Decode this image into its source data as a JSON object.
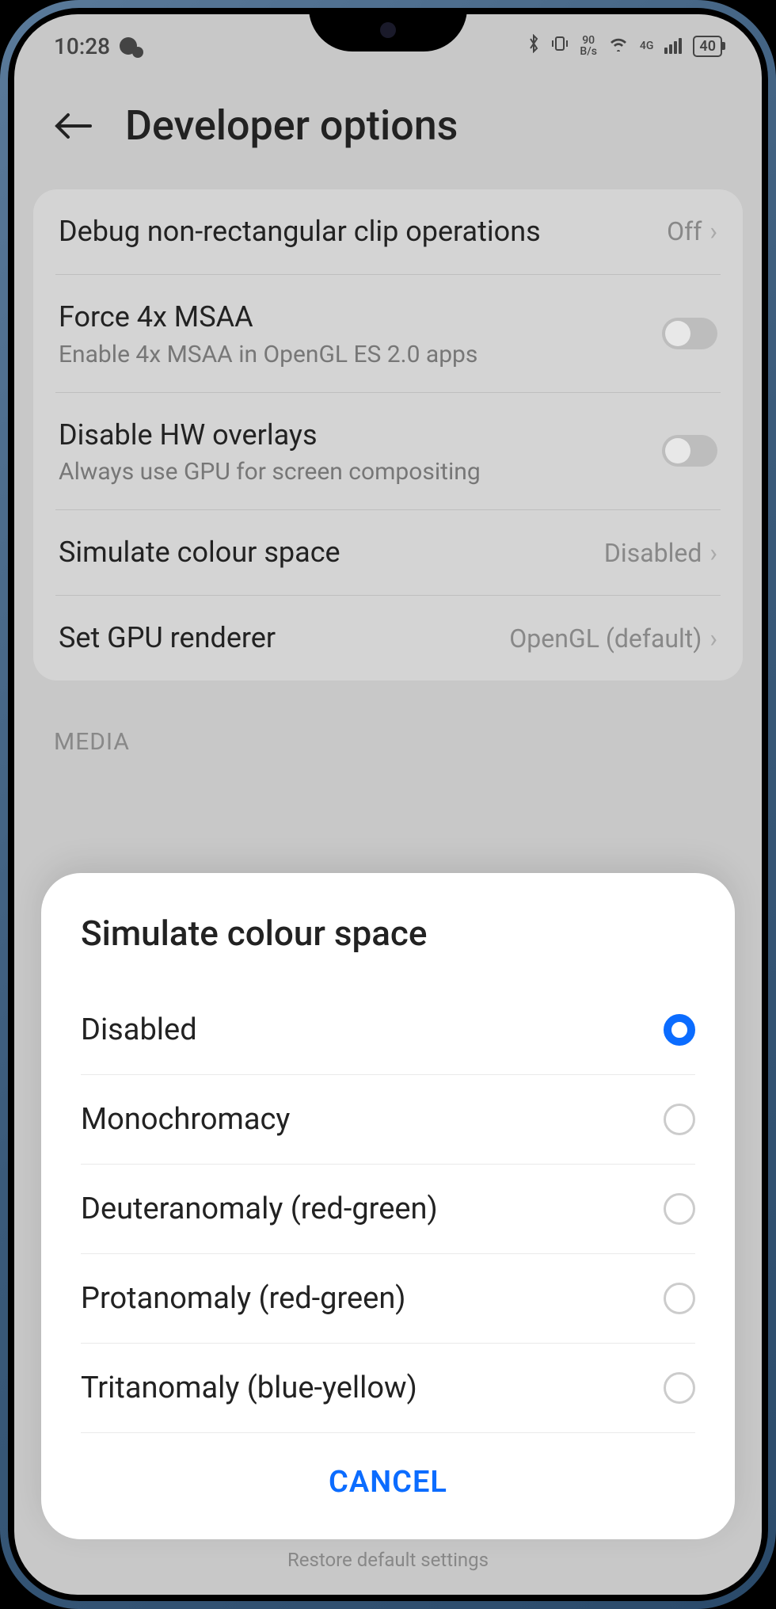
{
  "status": {
    "time": "10:28",
    "net_speed_top": "90",
    "net_speed_bottom": "B/s",
    "net_type": "4G",
    "battery": "40"
  },
  "header": {
    "title": "Developer options"
  },
  "rows": {
    "debug_clip": {
      "title": "Debug non-rectangular clip operations",
      "value": "Off"
    },
    "msaa": {
      "title": "Force 4x MSAA",
      "sub": "Enable 4x MSAA in OpenGL ES 2.0 apps"
    },
    "hw_overlays": {
      "title": "Disable HW overlays",
      "sub": "Always use GPU for screen compositing"
    },
    "sim_colour": {
      "title": "Simulate colour space",
      "value": "Disabled"
    },
    "gpu_renderer": {
      "title": "Set GPU renderer",
      "value": "OpenGL (default)"
    }
  },
  "section": {
    "media": "MEDIA"
  },
  "sheet": {
    "title": "Simulate colour space",
    "options": [
      {
        "label": "Disabled",
        "selected": true
      },
      {
        "label": "Monochromacy",
        "selected": false
      },
      {
        "label": "Deuteranomaly (red-green)",
        "selected": false
      },
      {
        "label": "Protanomaly (red-green)",
        "selected": false
      },
      {
        "label": "Tritanomaly (blue-yellow)",
        "selected": false
      }
    ],
    "cancel": "CANCEL"
  },
  "footer": {
    "restore": "Restore default settings"
  }
}
